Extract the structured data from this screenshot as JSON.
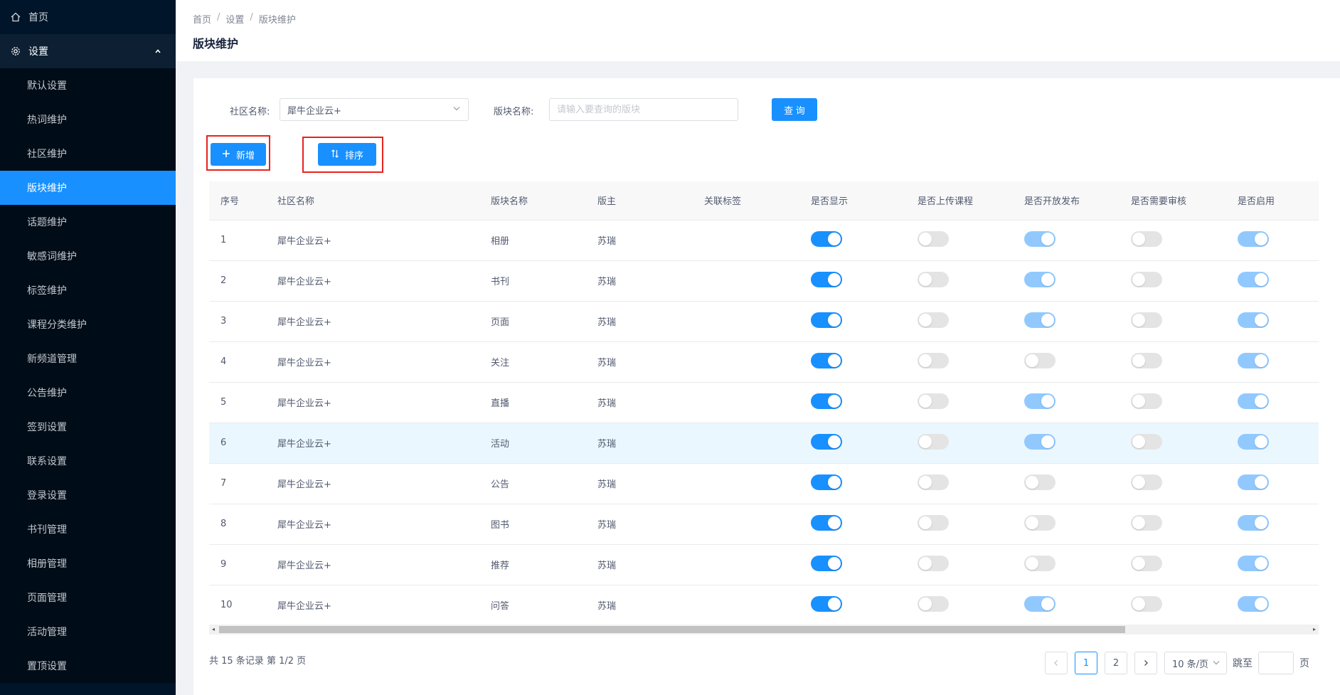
{
  "sidebar": {
    "home": {
      "label": "首页",
      "icon": "home-icon"
    },
    "settings": {
      "label": "设置",
      "icon": "gear-icon"
    },
    "items": [
      {
        "label": "默认设置"
      },
      {
        "label": "热词维护"
      },
      {
        "label": "社区维护"
      },
      {
        "label": "版块维护",
        "active": true
      },
      {
        "label": "话题维护"
      },
      {
        "label": "敏感词维护"
      },
      {
        "label": "标签维护"
      },
      {
        "label": "课程分类维护"
      },
      {
        "label": "新频道管理"
      },
      {
        "label": "公告维护"
      },
      {
        "label": "签到设置"
      },
      {
        "label": "联系设置"
      },
      {
        "label": "登录设置"
      },
      {
        "label": "书刊管理"
      },
      {
        "label": "相册管理"
      },
      {
        "label": "页面管理"
      },
      {
        "label": "活动管理"
      },
      {
        "label": "置顶设置"
      }
    ]
  },
  "breadcrumb": {
    "home": "首页",
    "settings": "设置",
    "current": "版块维护"
  },
  "page_title": "版块维护",
  "filters": {
    "community_label": "社区名称:",
    "community_value": "犀牛企业云+",
    "section_label": "版块名称:",
    "section_placeholder": "请输入要查询的版块",
    "query_button": "查 询"
  },
  "actions": {
    "add_label": "新增",
    "sort_label": "排序"
  },
  "table": {
    "columns": [
      "序号",
      "社区名称",
      "版块名称",
      "版主",
      "关联标签",
      "是否显示",
      "是否上传课程",
      "是否开放发布",
      "是否需要审核",
      "是否启用"
    ],
    "rows": [
      {
        "no": "1",
        "community": "犀牛企业云+",
        "section": "相册",
        "moderator": "苏瑞",
        "tags": "",
        "show": true,
        "upload": false,
        "publish": true,
        "review": false,
        "enabled": true
      },
      {
        "no": "2",
        "community": "犀牛企业云+",
        "section": "书刊",
        "moderator": "苏瑞",
        "tags": "",
        "show": true,
        "upload": false,
        "publish": true,
        "review": false,
        "enabled": true
      },
      {
        "no": "3",
        "community": "犀牛企业云+",
        "section": "页面",
        "moderator": "苏瑞",
        "tags": "",
        "show": true,
        "upload": false,
        "publish": true,
        "review": false,
        "enabled": true
      },
      {
        "no": "4",
        "community": "犀牛企业云+",
        "section": "关注",
        "moderator": "苏瑞",
        "tags": "",
        "show": true,
        "upload": false,
        "publish": false,
        "review": false,
        "enabled": true
      },
      {
        "no": "5",
        "community": "犀牛企业云+",
        "section": "直播",
        "moderator": "苏瑞",
        "tags": "",
        "show": true,
        "upload": false,
        "publish": true,
        "review": false,
        "enabled": true
      },
      {
        "no": "6",
        "community": "犀牛企业云+",
        "section": "活动",
        "moderator": "苏瑞",
        "tags": "",
        "show": true,
        "upload": false,
        "publish": true,
        "review": false,
        "enabled": true,
        "highlight": true
      },
      {
        "no": "7",
        "community": "犀牛企业云+",
        "section": "公告",
        "moderator": "苏瑞",
        "tags": "",
        "show": true,
        "upload": false,
        "publish": false,
        "review": false,
        "enabled": true
      },
      {
        "no": "8",
        "community": "犀牛企业云+",
        "section": "图书",
        "moderator": "苏瑞",
        "tags": "",
        "show": true,
        "upload": false,
        "publish": false,
        "review": false,
        "enabled": true
      },
      {
        "no": "9",
        "community": "犀牛企业云+",
        "section": "推荐",
        "moderator": "苏瑞",
        "tags": "",
        "show": true,
        "upload": false,
        "publish": false,
        "review": false,
        "enabled": true
      },
      {
        "no": "10",
        "community": "犀牛企业云+",
        "section": "问答",
        "moderator": "苏瑞",
        "tags": "",
        "show": true,
        "upload": false,
        "publish": true,
        "review": false,
        "enabled": true
      }
    ]
  },
  "pagination": {
    "total_text": "共 15 条记录 第 1/2 页",
    "pages": [
      "1",
      "2"
    ],
    "current_page": "1",
    "page_size": "10 条/页",
    "jump_label": "跳至",
    "page_suffix": "页"
  },
  "colors": {
    "primary": "#1890ff",
    "sidebar_bg": "#001529",
    "highlight_frame": "#e8231d"
  }
}
